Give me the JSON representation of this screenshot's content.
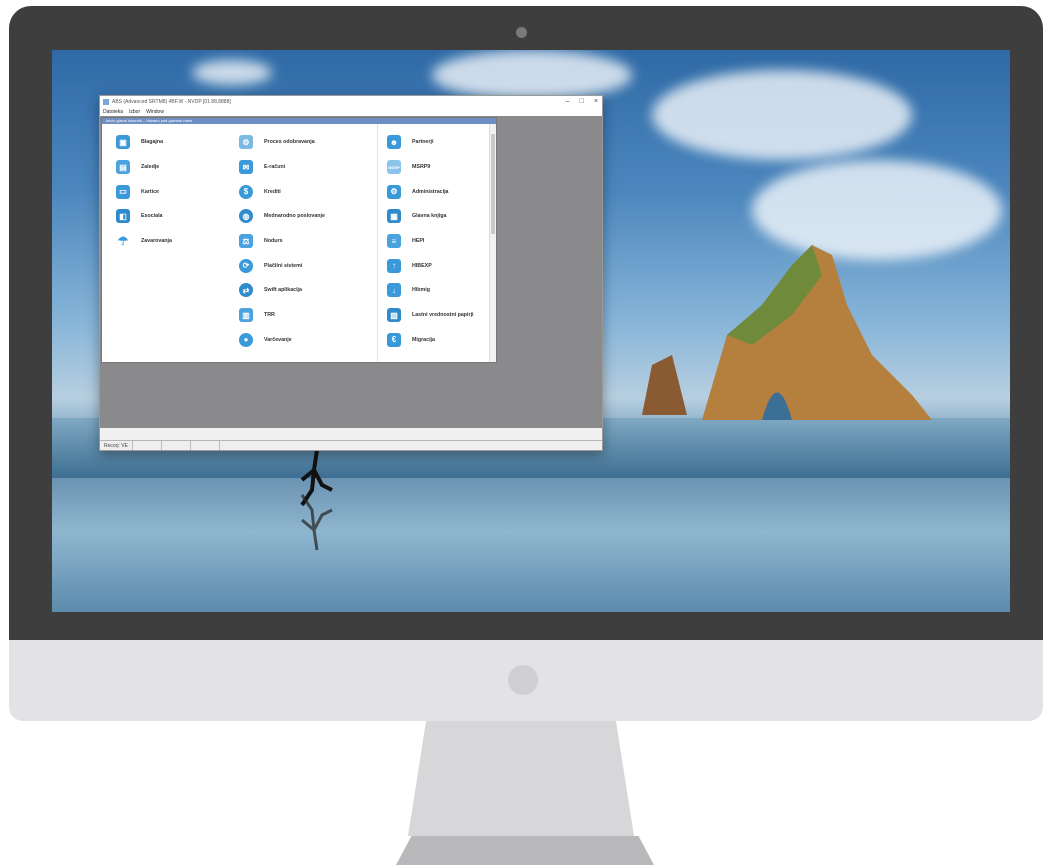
{
  "window": {
    "title": "ABS (Advanced SRTM8) 4BF.W - NVDP [01.88.8888]",
    "menu": [
      "Datoteka",
      "Izbor",
      "Window"
    ],
    "controls": {
      "minimize": "–",
      "maximize": "□",
      "close": "×"
    }
  },
  "inner_window": {
    "title": "Inicio glavni izbornik – Vezano pod glavnim meni"
  },
  "modules": {
    "col1": [
      {
        "label": "Blagajna",
        "icon": "cash-register-icon"
      },
      {
        "label": "Zaledje",
        "icon": "backoffice-icon"
      },
      {
        "label": "Kartice",
        "icon": "card-icon"
      },
      {
        "label": "Esociala",
        "icon": "social-icon"
      },
      {
        "label": "Zavarovanja",
        "icon": "umbrella-icon"
      }
    ],
    "col2": [
      {
        "label": "Proces odobravanja",
        "icon": "process-icon"
      },
      {
        "label": "E-računi",
        "icon": "e-invoice-icon"
      },
      {
        "label": "Krediti",
        "icon": "credit-icon"
      },
      {
        "label": "Mednarodno poslovanje",
        "icon": "globe-icon"
      },
      {
        "label": "Nodurs",
        "icon": "gavel-icon"
      },
      {
        "label": "Plačilni sistemi",
        "icon": "payment-systems-icon"
      },
      {
        "label": "Swift aplikacija",
        "icon": "swift-icon"
      },
      {
        "label": "TRR",
        "icon": "account-icon"
      },
      {
        "label": "Varčevanje",
        "icon": "piggy-bank-icon"
      }
    ],
    "col3": [
      {
        "label": "Partnerji",
        "icon": "partners-icon"
      },
      {
        "label": "MSRP9",
        "icon": "msrp9-icon"
      },
      {
        "label": "Administracija",
        "icon": "admin-icon"
      },
      {
        "label": "Glavna knjiga",
        "icon": "ledger-icon"
      },
      {
        "label": "HEPI",
        "icon": "hepi-icon"
      },
      {
        "label": "HIBEXP",
        "icon": "export-icon"
      },
      {
        "label": "Hibmig",
        "icon": "migrate-icon"
      },
      {
        "label": "Lastni vrednostni papirji",
        "icon": "securities-icon"
      },
      {
        "label": "Migracija",
        "icon": "euro-icon"
      }
    ]
  },
  "statusbar": {
    "ready": "Recorj: VE"
  },
  "colors": {
    "accent": "#3a9ad9",
    "desktop_mdi": "#8a898b"
  }
}
